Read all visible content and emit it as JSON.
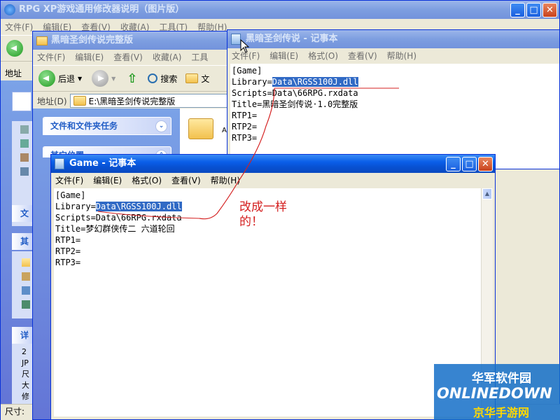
{
  "back_window": {
    "title": "RPG XP游戏通用修改器说明（图片版）",
    "menu": [
      "文件(F)",
      "编辑(E)",
      "查看(V)",
      "收藏(A)",
      "工具(T)",
      "帮助(H)"
    ],
    "address_label": "地址",
    "side_labels": [
      "文",
      "其",
      "详"
    ],
    "side_details": [
      "2",
      "JP",
      "尺",
      "大",
      "修"
    ],
    "status_text": "尺寸:"
  },
  "explorer": {
    "title": "黑暗圣剑传说完整版",
    "menu": [
      "文件(F)",
      "编辑(E)",
      "查看(V)",
      "收藏(A)",
      "工具"
    ],
    "toolbar": {
      "back": "后退",
      "search": "搜索",
      "folders": "文"
    },
    "address_label": "地址(D)",
    "address_path": "E:\\黑暗圣剑传说完整版",
    "task_header": "文件和文件夹任务",
    "task_header2": "其它位置",
    "folder_label": "Au"
  },
  "notepad_top": {
    "title": "黑暗圣剑传说 - 记事本",
    "menu": [
      "文件(F)",
      "编辑(E)",
      "格式(O)",
      "查看(V)",
      "帮助(H)"
    ],
    "lines": {
      "l1": "[Game]",
      "l2_prefix": "Library=",
      "l2_sel": "Data\\RGSS100J.dll",
      "l3": "Scripts=Data\\66RPG.rxdata",
      "l4": "Title=黑暗圣剑传说·1.0完整版",
      "l5": "RTP1=",
      "l6": "RTP2=",
      "l7": "RTP3="
    }
  },
  "notepad_front": {
    "title": "Game - 记事本",
    "menu": [
      "文件(F)",
      "编辑(E)",
      "格式(O)",
      "查看(V)",
      "帮助(H)"
    ],
    "lines": {
      "l1": "[Game]",
      "l2_prefix": "Library=",
      "l2_sel": "Data\\RGSS100J.dll",
      "l3": "Scripts=Data\\66RPG.rxdata",
      "l4": "Title=梦幻群侠传二 六道轮回",
      "l5": "RTP1=",
      "l6": "RTP2=",
      "l7": "RTP3="
    }
  },
  "annotation": {
    "line1": "改成一样",
    "line2": "的！",
    "color": "#d42020"
  },
  "watermark": {
    "cn": "华军软件园",
    "en": "ONLINEDOWN",
    "sub": "京华手游网"
  }
}
